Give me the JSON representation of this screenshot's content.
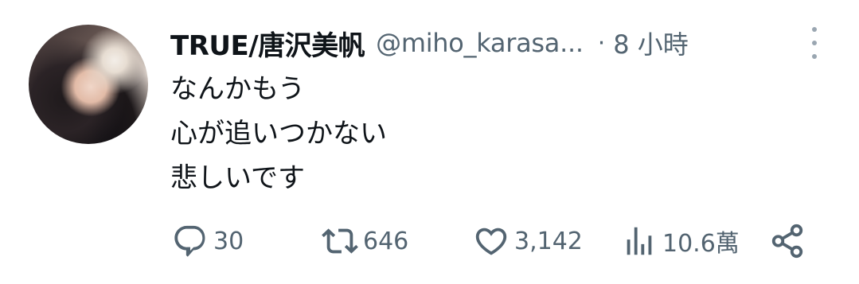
{
  "tweet": {
    "display_name": "TRUE/唐沢美帆",
    "handle": "@miho_karasa...",
    "separator": "·",
    "time": "8 小時",
    "text_lines": [
      "なんかもう",
      "心が追いつかない",
      "悲しいです"
    ],
    "stats": {
      "replies": "30",
      "retweets": "646",
      "likes": "3,142",
      "views": "10.6萬"
    }
  },
  "icons": {
    "avatar": "profile-photo",
    "more": "more-vertical-icon",
    "reply": "reply-icon",
    "retweet": "retweet-icon",
    "like": "heart-icon",
    "views": "views-icon",
    "share": "share-icon"
  },
  "colors": {
    "text_primary": "#0f1419",
    "text_secondary": "#536471",
    "background": "#ffffff"
  }
}
